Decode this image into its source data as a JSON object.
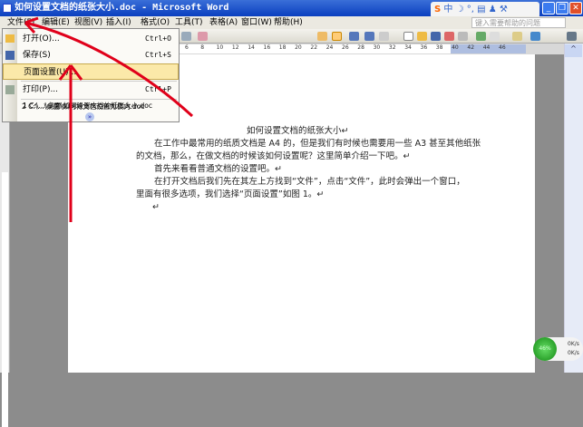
{
  "window": {
    "title": "如何设置文档的纸张大小.doc - Microsoft Word",
    "minimize": "_",
    "restore": "❐",
    "close": "✕"
  },
  "ime": {
    "logo": "S",
    "text": "中 ☽ °, ▤ ♟ ⚒"
  },
  "menubar": {
    "items": [
      "文件(F)",
      "编辑(E)",
      "视图(V)",
      "插入(I)",
      "格式(O)",
      "工具(T)",
      "表格(A)",
      "窗口(W)",
      "帮助(H)"
    ],
    "help_placeholder": "键入需要帮助的问题"
  },
  "ruler": {
    "ticks": [
      "6",
      "8",
      "10",
      "12",
      "14",
      "16",
      "18",
      "20",
      "22",
      "24",
      "26",
      "28",
      "30",
      "32",
      "34",
      "36",
      "38",
      "40",
      "42",
      "44",
      "46"
    ]
  },
  "file_menu": {
    "items": [
      {
        "label": "打开(O)...",
        "shortcut": "Ctrl+O"
      },
      {
        "label": "保存(S)",
        "shortcut": "Ctrl+S"
      },
      {
        "label": "页面设置(U)...",
        "shortcut": ""
      },
      {
        "label": "打印(P)...",
        "shortcut": "Ctrl+P"
      },
      {
        "label": "1 C:\\...\\桌面\\如何设置文档的纸张大小.doc",
        "shortcut": ""
      },
      {
        "label": "2 C:\\...\\桌面\\如何将文档设置为横向.doc",
        "shortcut": ""
      }
    ],
    "expand": "»"
  },
  "document": {
    "title": "如何设置文档的纸张大小↵",
    "lines": [
      "在工作中最常用的纸质文档是 A4 的，但是我们有时候也需要用一些 A3 甚至其他纸张",
      "的文档，那么，在做文档的时候该如何设置呢？这里简单介绍一下吧。↵",
      "首先来看看普通文档的设置吧。↵",
      "在打开文档后我们先在其左上方找到“文件”，点击“文件”，此时会弹出一个窗口，",
      "里面有很多选项，我们选择“页面设置”如图 1。↵",
      "↵"
    ]
  },
  "network": {
    "percent": "46%",
    "up": "0K/s",
    "down": "0K/s"
  },
  "colors": {
    "titlebar": "#0a3fbf",
    "annotation_arrow": "#e0001a",
    "highlight": "#fbe9a9"
  }
}
